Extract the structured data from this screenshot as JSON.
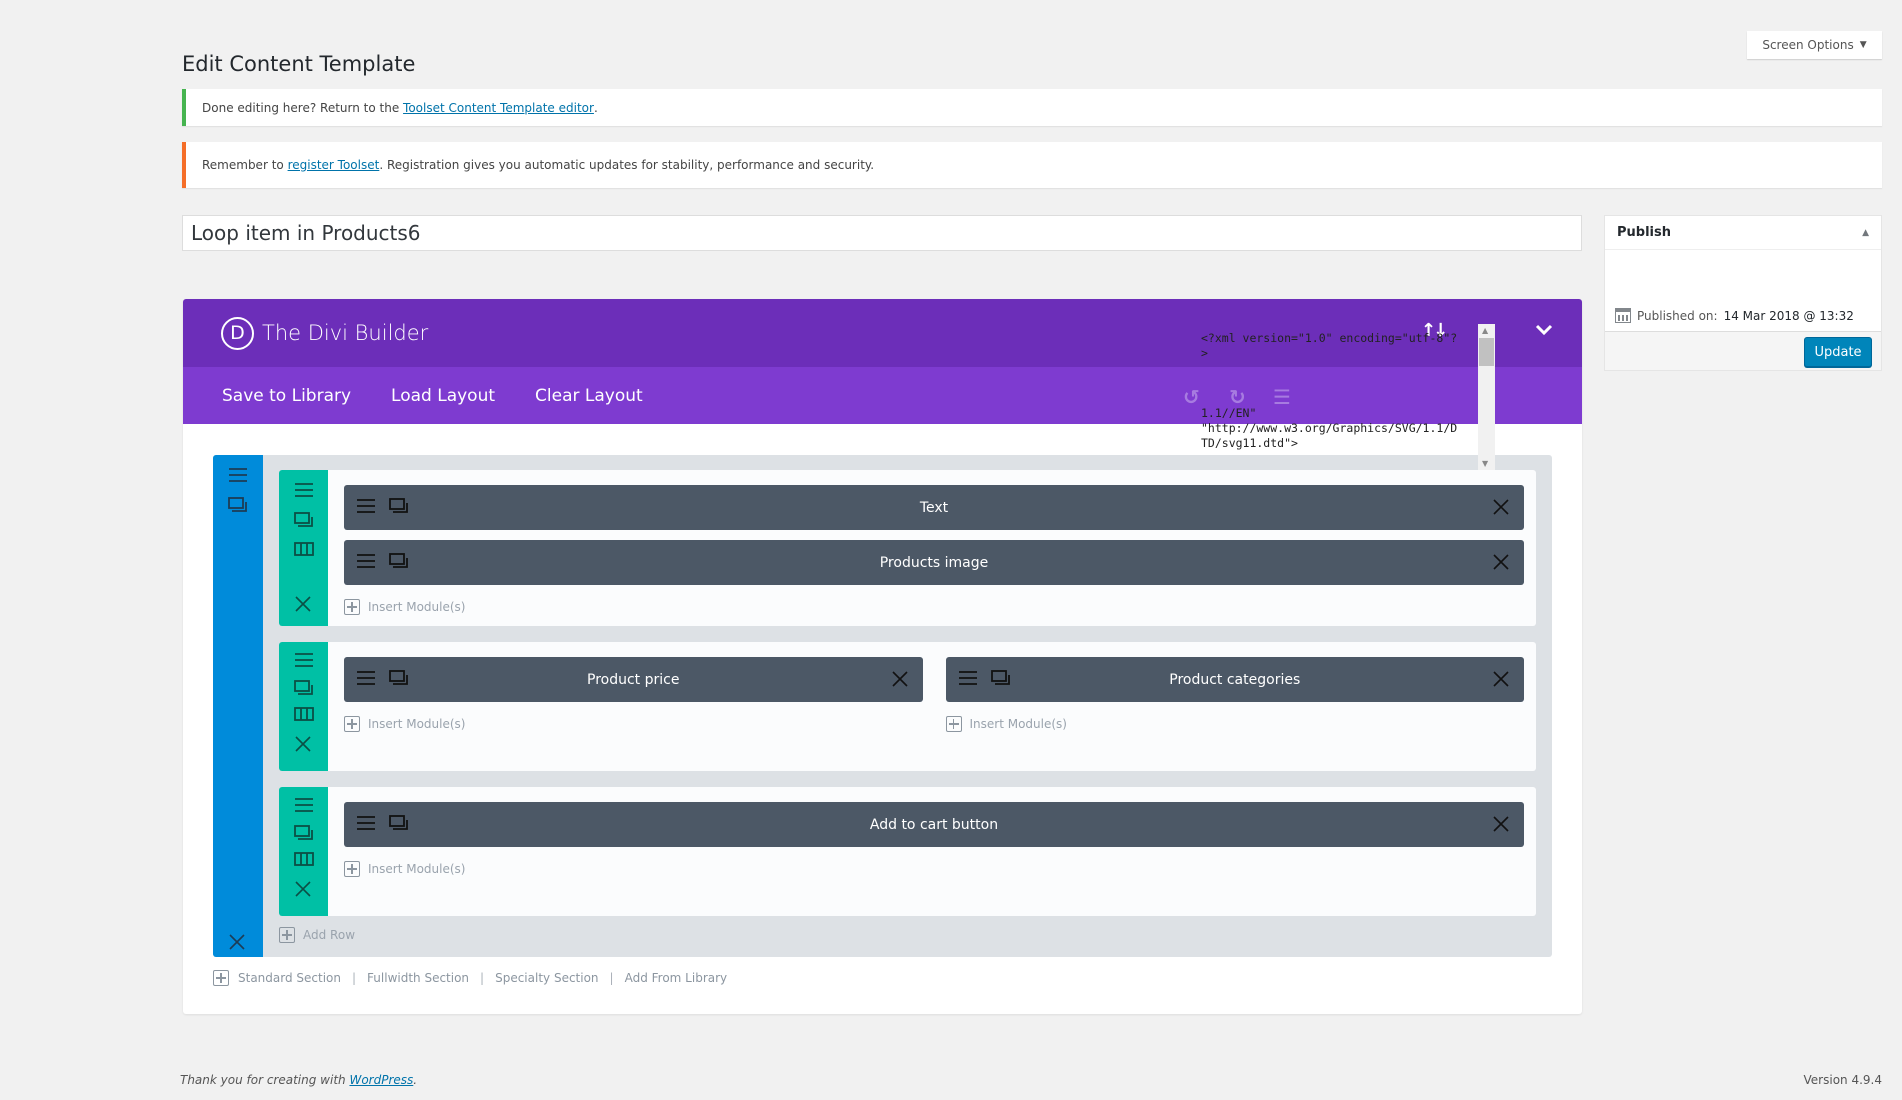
{
  "screen_options": {
    "label": "Screen Options",
    "icon": "triangle-down-icon"
  },
  "page_title": "Edit Content Template",
  "notices": {
    "success": {
      "prefix": "Done editing here? Return to the ",
      "link": "Toolset Content Template editor",
      "suffix": "."
    },
    "error": {
      "prefix": "Remember to ",
      "link": "register Toolset",
      "suffix": ". Registration gives you automatic updates for stability, performance and security."
    }
  },
  "title_input": {
    "value": "Loop item in Products6"
  },
  "publish": {
    "title": "Publish",
    "published_label": "Published on:",
    "published_date": "14 Mar 2018 @ 13:32",
    "update_label": "Update"
  },
  "builder": {
    "logo_letter": "D",
    "title": "The Divi Builder",
    "toolbar": {
      "save": "Save to Library",
      "load": "Load Layout",
      "clear": "Clear Layout"
    },
    "xml_overlay": [
      "<?xml version=\"1.0\" encoding=\"utf-8\"?",
      ">",
      "",
      "",
      "",
      "1.1//EN\"",
      "\"http://www.w3.org/Graphics/SVG/1.1/D",
      "TD/svg11.dtd\">"
    ],
    "rows": [
      {
        "columns": [
          {
            "modules": [
              "Text",
              "Products image"
            ],
            "insert_label": "Insert Module(s)"
          }
        ]
      },
      {
        "columns": [
          {
            "modules": [
              "Product price"
            ],
            "insert_label": "Insert Module(s)"
          },
          {
            "modules": [
              "Product categories"
            ],
            "insert_label": "Insert Module(s)"
          }
        ]
      },
      {
        "columns": [
          {
            "modules": [
              "Add to cart button"
            ],
            "insert_label": "Insert Module(s)"
          }
        ]
      }
    ],
    "add_row_label": "Add Row",
    "section_links": [
      "Standard Section",
      "Fullwidth Section",
      "Specialty Section",
      "Add From Library"
    ]
  },
  "colors": {
    "header": "#6c2eb9",
    "toolbar": "#7e3bd0",
    "section": "#008bda",
    "row": "#00c0a5",
    "module": "#4c5866",
    "update_button": "#0085ba"
  },
  "footer": {
    "thanks_prefix": "Thank you for creating with ",
    "thanks_link": "WordPress",
    "thanks_suffix": ".",
    "version": "Version 4.9.4"
  }
}
